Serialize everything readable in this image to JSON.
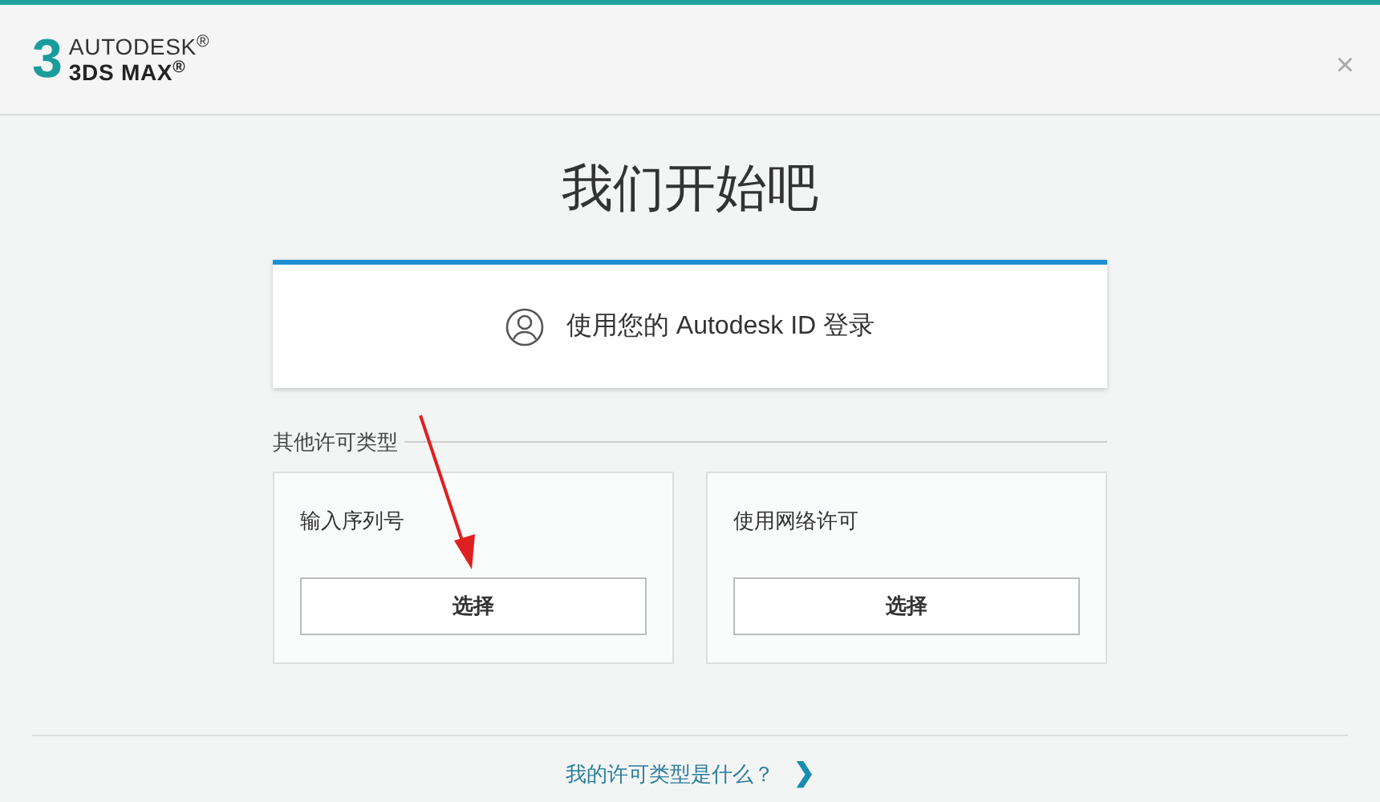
{
  "header": {
    "logo_mark": "3",
    "brand": "AUTODESK$^{®}$",
    "product": "3DS MAX$^{®}$",
    "close": "×"
  },
  "title": "我们开始吧",
  "sign_in": {
    "label": "使用您的 Autodesk ID 登录"
  },
  "other_section": {
    "label": "其他许可类型",
    "options": [
      {
        "label": "输入序列号",
        "button": "选择",
        "annotated": true
      },
      {
        "label": "使用网络许可",
        "button": "选择",
        "annotated": false
      }
    ]
  },
  "footer": {
    "link": "我的许可类型是什么？",
    "chevron": "❯"
  }
}
